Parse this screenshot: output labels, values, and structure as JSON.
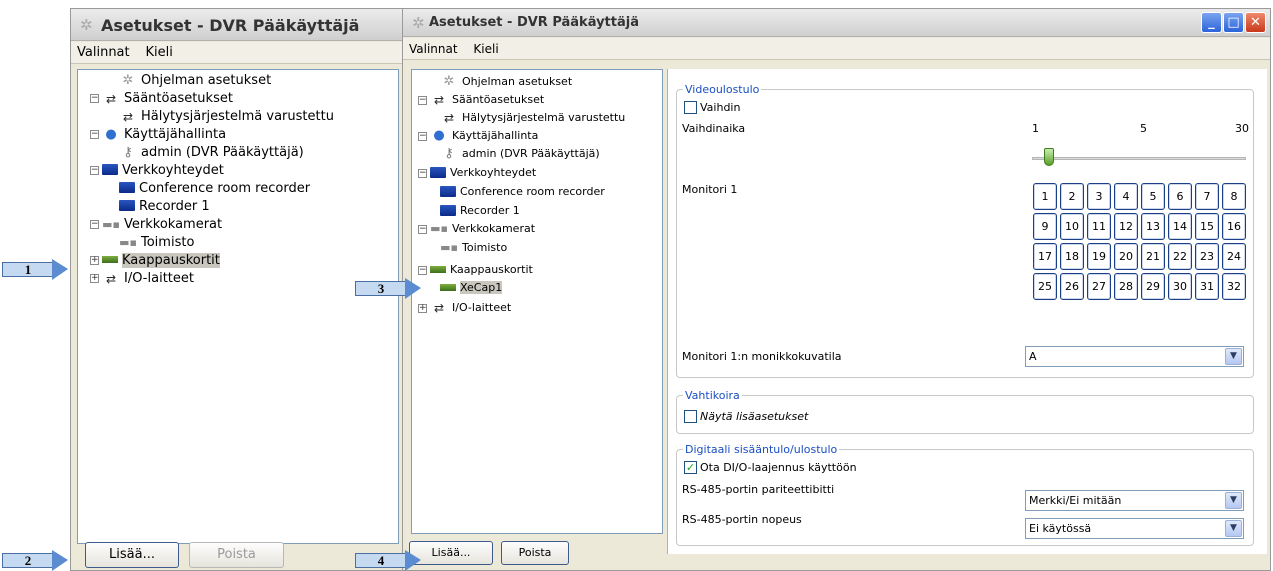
{
  "left_window": {
    "title": "Asetukset - DVR Pääkäyttäjä",
    "menu": [
      "Valinnat",
      "Kieli"
    ],
    "tree": [
      {
        "label": "Ohjelman asetukset",
        "icon": "gear-icon"
      },
      {
        "label": "Sääntöasetukset",
        "icon": "arrows-icon"
      },
      {
        "label": "Hälytysjärjestelmä varustettu",
        "icon": "arrows-icon"
      },
      {
        "label": "Käyttäjähallinta",
        "icon": "user-icon"
      },
      {
        "label": "admin (DVR Pääkäyttäjä)",
        "icon": "key-icon"
      },
      {
        "label": "Verkkoyhteydet",
        "icon": "monitor-icon"
      },
      {
        "label": "Conference room recorder",
        "icon": "monitor-icon"
      },
      {
        "label": "Recorder 1",
        "icon": "monitor-icon"
      },
      {
        "label": "Verkkokamerat",
        "icon": "camera-icon"
      },
      {
        "label": "Toimisto",
        "icon": "camera-icon"
      },
      {
        "label": "Kaappauskortit",
        "icon": "capture-card-icon"
      },
      {
        "label": "I/O-laitteet",
        "icon": "arrows-icon"
      }
    ],
    "add_button": "Lisää...",
    "remove_button": "Poista"
  },
  "right_window": {
    "title": "Asetukset - DVR Pääkäyttäjä",
    "menu": [
      "Valinnat",
      "Kieli"
    ],
    "tree": [
      {
        "label": "Ohjelman asetukset",
        "icon": "gear-icon"
      },
      {
        "label": "Sääntöasetukset",
        "icon": "arrows-icon"
      },
      {
        "label": "Hälytysjärjestelmä varustettu",
        "icon": "arrows-icon"
      },
      {
        "label": "Käyttäjähallinta",
        "icon": "user-icon"
      },
      {
        "label": "admin (DVR Pääkäyttäjä)",
        "icon": "key-icon"
      },
      {
        "label": "Verkkoyhteydet",
        "icon": "monitor-icon"
      },
      {
        "label": "Conference room recorder",
        "icon": "monitor-icon"
      },
      {
        "label": "Recorder 1",
        "icon": "monitor-icon"
      },
      {
        "label": "Verkkokamerat",
        "icon": "camera-icon"
      },
      {
        "label": "Toimisto",
        "icon": "camera-icon"
      },
      {
        "label": "Kaappauskortit",
        "icon": "capture-card-icon"
      },
      {
        "label": "XeCap1",
        "icon": "capture-card-icon"
      },
      {
        "label": "I/O-laitteet",
        "icon": "arrows-icon"
      }
    ],
    "add_button": "Lisää...",
    "remove_button": "Poista",
    "video_output": {
      "group_title": "Videoulostulo",
      "switch_checkbox": "Vaihdin",
      "switch_checked": false,
      "switch_time_label": "Vaihdinaika",
      "slider_min": "1",
      "slider_mid": "5",
      "slider_max": "30",
      "slider_value": 3,
      "monitor_label": "Monitori 1",
      "monitor_buttons": [
        "1",
        "2",
        "3",
        "4",
        "5",
        "6",
        "7",
        "8",
        "9",
        "10",
        "11",
        "12",
        "13",
        "14",
        "15",
        "16",
        "17",
        "18",
        "19",
        "20",
        "21",
        "22",
        "23",
        "24",
        "25",
        "26",
        "27",
        "28",
        "29",
        "30",
        "31",
        "32"
      ],
      "multiview_label": "Monitori 1:n monikkokuvatila",
      "multiview_value": "A"
    },
    "watchdog": {
      "group_title": "Vahtikoira",
      "show_more_checkbox": "Näytä lisäasetukset",
      "show_more_checked": false
    },
    "digital_io": {
      "group_title": "Digitaali sisääntulo/ulostulo",
      "enable_checkbox": "Ota DI/O-laajennus käyttöön",
      "enable_checked": true,
      "parity_label": "RS-485-portin pariteettibitti",
      "parity_value": "Merkki/Ei mitään",
      "speed_label": "RS-485-portin nopeus",
      "speed_value": "Ei käytössä"
    }
  },
  "callouts": [
    "1",
    "2",
    "3",
    "4"
  ]
}
